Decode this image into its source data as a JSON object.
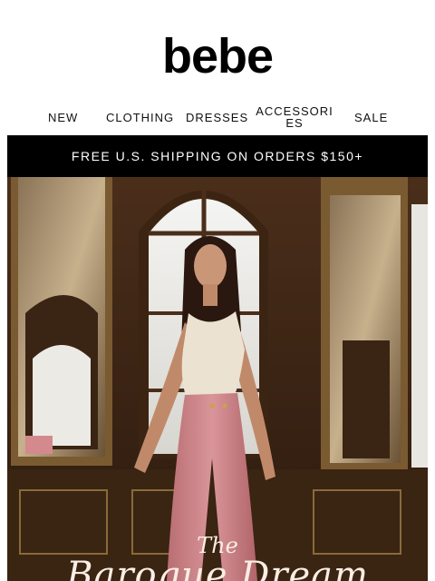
{
  "brand": {
    "logo_text": "bebe"
  },
  "nav": {
    "items": [
      "NEW",
      "CLOTHING",
      "DRESSES",
      "ACCESSORIES",
      "SALE"
    ]
  },
  "banner": {
    "text": "FREE U.S. SHIPPING ON ORDERS $150+"
  },
  "hero": {
    "kicker": "The",
    "title": "Baroque Dream",
    "colors": {
      "wall": "#5a3a22",
      "gold": "#b8893c",
      "top": "#eee4d6",
      "pants": "#d48a8c"
    }
  }
}
